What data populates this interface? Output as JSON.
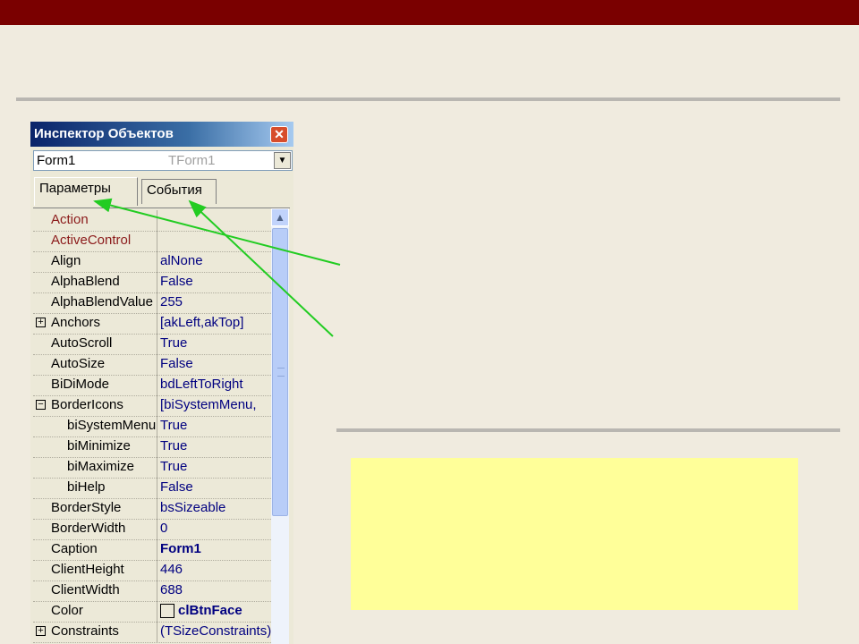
{
  "inspector": {
    "title": "Инспектор Объектов",
    "close_glyph": "✕",
    "object_name": "Form1",
    "object_type": "TForm1",
    "combo_arrow": "▼",
    "tabs": [
      {
        "label": "Параметры"
      },
      {
        "label": "События"
      }
    ],
    "properties": [
      {
        "name": "Action",
        "value": "",
        "red": true
      },
      {
        "name": "ActiveControl",
        "value": "",
        "red": true
      },
      {
        "name": "Align",
        "value": "alNone"
      },
      {
        "name": "AlphaBlend",
        "value": "False"
      },
      {
        "name": "AlphaBlendValue",
        "value": "255"
      },
      {
        "name": "Anchors",
        "value": "[akLeft,akTop]",
        "expander": "+"
      },
      {
        "name": "AutoScroll",
        "value": "True"
      },
      {
        "name": "AutoSize",
        "value": "False"
      },
      {
        "name": "BiDiMode",
        "value": "bdLeftToRight"
      },
      {
        "name": "BorderIcons",
        "value": "[biSystemMenu,",
        "expander": "−"
      },
      {
        "name": "biSystemMenu",
        "value": "True",
        "sub": true
      },
      {
        "name": "biMinimize",
        "value": "True",
        "sub": true
      },
      {
        "name": "biMaximize",
        "value": "True",
        "sub": true
      },
      {
        "name": "biHelp",
        "value": "False",
        "sub": true
      },
      {
        "name": "BorderStyle",
        "value": "bsSizeable"
      },
      {
        "name": "BorderWidth",
        "value": "0"
      },
      {
        "name": "Caption",
        "value": "Form1",
        "bold": true
      },
      {
        "name": "ClientHeight",
        "value": "446"
      },
      {
        "name": "ClientWidth",
        "value": "688"
      },
      {
        "name": "Color",
        "value": "clBtnFace",
        "bold": true,
        "swatch": true
      },
      {
        "name": "Constraints",
        "value": "(TSizeConstraints)",
        "expander": "+"
      }
    ],
    "scroll_up_glyph": "▲"
  },
  "colors": {
    "top_bar": "#7a0000",
    "background": "#f0ebdf",
    "note_box": "#ffff99",
    "arrow": "#22cc22"
  }
}
